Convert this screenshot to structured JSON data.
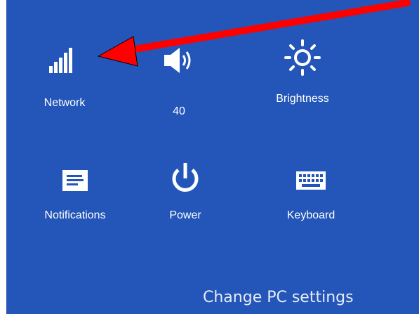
{
  "quick_settings": {
    "network": {
      "label": "Network",
      "icon": "signal-bars-icon"
    },
    "volume": {
      "label": "40",
      "icon": "speaker-icon"
    },
    "brightness": {
      "label": "Brightness",
      "icon": "sun-icon"
    },
    "notifications": {
      "label": "Notifications",
      "icon": "message-icon"
    },
    "power": {
      "label": "Power",
      "icon": "power-icon"
    },
    "keyboard": {
      "label": "Keyboard",
      "icon": "keyboard-icon"
    }
  },
  "footer": {
    "change_pc_settings_label": "Change PC settings"
  },
  "annotation": {
    "arrow_color": "#ff0000",
    "arrow_target": "network"
  },
  "colors": {
    "panel_bg": "#2356b8",
    "text": "#ffffff"
  }
}
